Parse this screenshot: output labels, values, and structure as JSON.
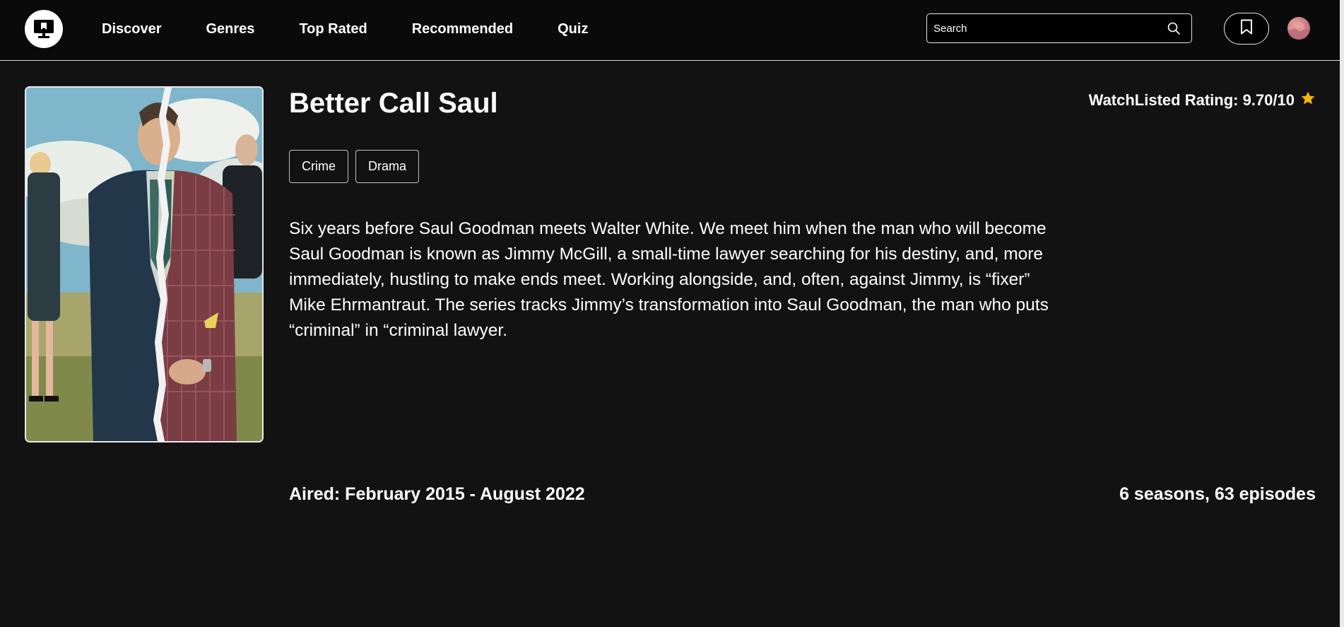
{
  "nav": {
    "links": [
      "Discover",
      "Genres",
      "Top Rated",
      "Recommended",
      "Quiz"
    ],
    "search_placeholder": "Search"
  },
  "show": {
    "title": "Better Call Saul",
    "rating_label": "WatchListed Rating: 9.70/10",
    "genres": [
      "Crime",
      "Drama"
    ],
    "overview": "Six years before Saul Goodman meets Walter White. We meet him when the man who will become Saul Goodman is known as Jimmy McGill, a small-time lawyer searching for his destiny, and, more immediately, hustling to make ends meet. Working alongside, and, often, against Jimmy, is “fixer” Mike Ehrmantraut. The series tracks Jimmy’s transformation into Saul Goodman, the man who puts “criminal” in “criminal lawyer.",
    "aired": "Aired: February 2015 - August 2022",
    "seasons_episodes": "6 seasons, 63 episodes"
  },
  "icons": {
    "logo": "tv-logo-icon",
    "search": "search-icon",
    "bookmark": "bookmark-icon",
    "star": "star-icon"
  },
  "colors": {
    "background": "#121212",
    "navbar": "#0a0a0b",
    "star": "#f5b50a",
    "text": "#ffffff"
  }
}
